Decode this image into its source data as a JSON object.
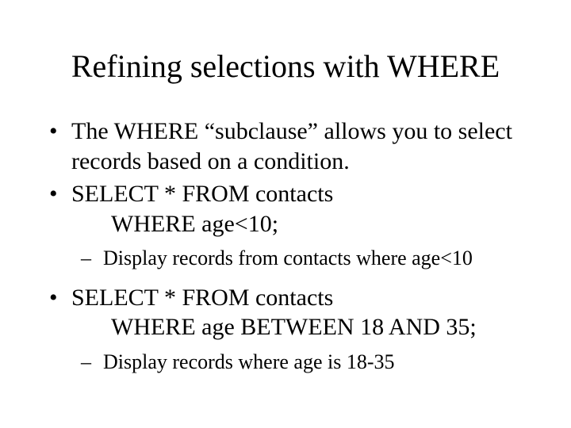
{
  "title": "Refining selections with WHERE",
  "bullets": {
    "b1": "The WHERE “subclause” allows you to select records based on a condition.",
    "b2_line1": "SELECT * FROM contacts",
    "b2_line2": "WHERE age<10;",
    "b2_sub": "Display records from contacts where age<10",
    "b3_line1": "SELECT * FROM contacts",
    "b3_line2": "WHERE age BETWEEN 18 AND 35;",
    "b3_sub": "Display records where age is 18-35"
  }
}
